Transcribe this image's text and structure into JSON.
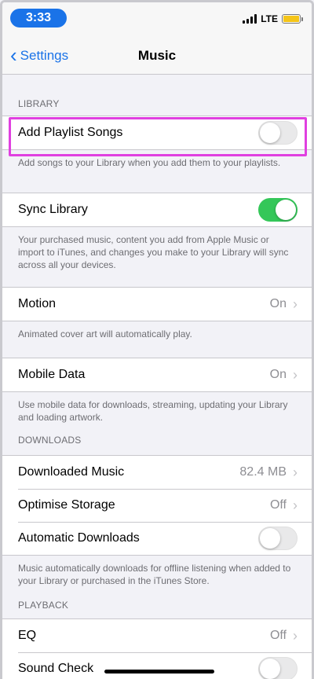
{
  "status_bar": {
    "time": "3:33",
    "network": "LTE"
  },
  "nav": {
    "back_label": "Settings",
    "title": "Music"
  },
  "sections": {
    "library": {
      "header": "LIBRARY",
      "add_playlist": {
        "label": "Add Playlist Songs",
        "toggle": false,
        "footer": "Add songs to your Library when you add them to your playlists."
      },
      "sync_library": {
        "label": "Sync Library",
        "toggle": true,
        "footer": "Your purchased music, content you add from Apple Music or import to iTunes, and changes you make to your Library will sync across all your devices."
      },
      "motion": {
        "label": "Motion",
        "value": "On",
        "footer": "Animated cover art will automatically play."
      },
      "mobile_data": {
        "label": "Mobile Data",
        "value": "On",
        "footer": "Use mobile data for downloads, streaming, updating your Library and loading artwork."
      }
    },
    "downloads": {
      "header": "DOWNLOADS",
      "downloaded_music": {
        "label": "Downloaded Music",
        "value": "82.4 MB"
      },
      "optimise_storage": {
        "label": "Optimise Storage",
        "value": "Off"
      },
      "automatic_downloads": {
        "label": "Automatic Downloads",
        "toggle": false
      },
      "footer": "Music automatically downloads for offline listening when added to your Library or purchased in the iTunes Store."
    },
    "playback": {
      "header": "PLAYBACK",
      "eq": {
        "label": "EQ",
        "value": "Off"
      },
      "sound_check": {
        "label": "Sound Check",
        "toggle": false
      }
    }
  },
  "colors": {
    "accent": "#1a73e8",
    "toggle_on": "#34c759",
    "highlight": "#e040e0"
  },
  "icons": {
    "back": "chevron-left-icon",
    "disclosure": "chevron-right-icon"
  }
}
